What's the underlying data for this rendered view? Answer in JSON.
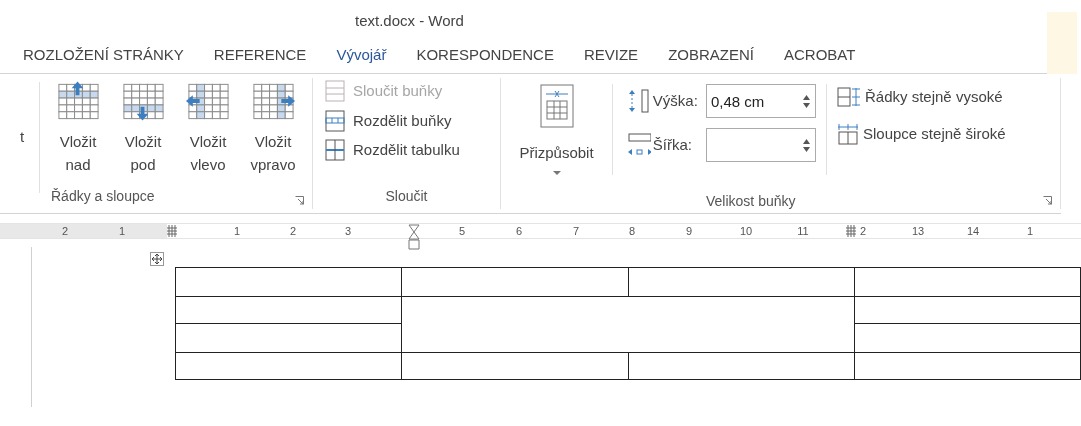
{
  "window": {
    "title": "text.docx - Word"
  },
  "tabs": [
    {
      "label": "ROZLOŽENÍ STRÁNKY",
      "selected": false
    },
    {
      "label": "REFERENCE",
      "selected": false
    },
    {
      "label": "Vývojář",
      "selected": true
    },
    {
      "label": "KORESPONDENCE",
      "selected": false
    },
    {
      "label": "REVIZE",
      "selected": false
    },
    {
      "label": "ZOBRAZENÍ",
      "selected": false
    },
    {
      "label": "ACROBAT",
      "selected": false
    }
  ],
  "ribbon": {
    "cut_label": "t",
    "groups": [
      {
        "label": "Řádky a sloupce",
        "launcher": true,
        "kind": "insert",
        "buttons": [
          {
            "line1": "Vložit",
            "line2": "nad",
            "kind": "above"
          },
          {
            "line1": "Vložit",
            "line2": "pod",
            "kind": "below"
          },
          {
            "line1": "Vložit",
            "line2": "vlevo",
            "kind": "left"
          },
          {
            "line1": "Vložit",
            "line2": "vpravo",
            "kind": "right"
          }
        ]
      },
      {
        "label": "Sloučit",
        "launcher": false,
        "kind": "merge",
        "buttons": [
          {
            "label": "Sloučit buňky",
            "disabled": true,
            "kind": "merge"
          },
          {
            "label": "Rozdělit buňky",
            "disabled": false,
            "kind": "split-cells"
          },
          {
            "label": "Rozdělit tabulku",
            "disabled": false,
            "kind": "split-table"
          }
        ]
      },
      {
        "label": "Velikost buňky",
        "launcher": true,
        "kind": "size",
        "autofit": {
          "label": "Přizpůsobit"
        },
        "fields": [
          {
            "label": "Výška:",
            "value": "0,48 cm",
            "kind": "height"
          },
          {
            "label": "Šířka:",
            "kind": "width"
          }
        ],
        "buttons": [
          {
            "label": "Řádky stejně vysoké",
            "kind": "rows"
          },
          {
            "label": "Sloupce stejně široké",
            "kind": "cols"
          }
        ]
      }
    ]
  },
  "ruler": {
    "items": [
      {
        "kind": "number",
        "text": "2"
      },
      {
        "kind": "number",
        "text": "1"
      },
      {
        "kind": "marker"
      },
      {
        "kind": "number",
        "text": "1"
      },
      {
        "kind": "number",
        "text": "2"
      },
      {
        "kind": "number",
        "text": "3"
      },
      {
        "kind": "indent"
      },
      {
        "kind": "number",
        "text": "5"
      },
      {
        "kind": "number",
        "text": "6"
      },
      {
        "kind": "number",
        "text": "7"
      },
      {
        "kind": "number",
        "text": "8"
      },
      {
        "kind": "number",
        "text": "9"
      },
      {
        "kind": "number",
        "text": "10"
      },
      {
        "kind": "number",
        "text": "11"
      },
      {
        "kind": "marker"
      },
      {
        "kind": "number",
        "text": "2"
      },
      {
        "kind": "number",
        "text": "13"
      },
      {
        "kind": "number",
        "text": "14"
      },
      {
        "kind": "number",
        "text": "1"
      }
    ]
  }
}
